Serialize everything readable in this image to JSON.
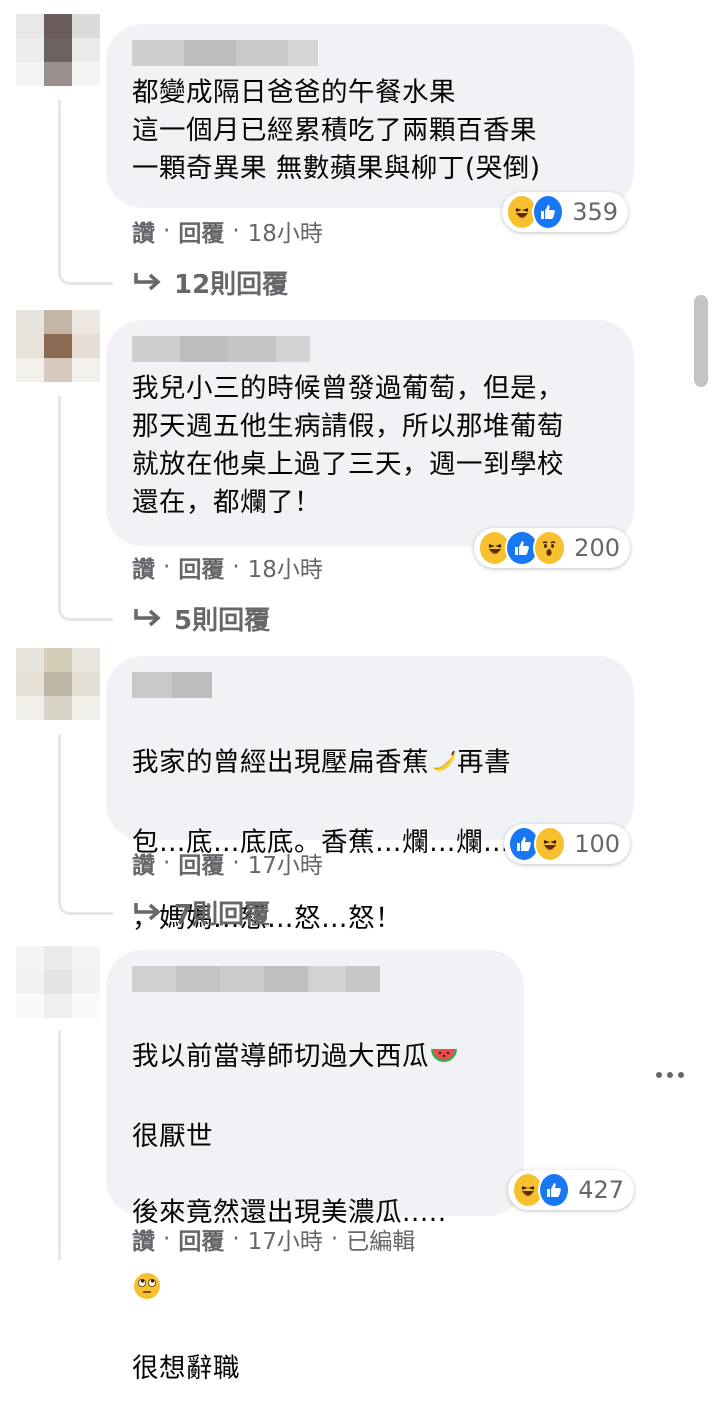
{
  "comments": [
    {
      "lines": "都變成隔日爸爸的午餐水果\n這一個月已經累積吃了兩顆百香果\n一顆奇異果 無數蘋果與柳丁(哭倒)",
      "reactions": [
        "haha",
        "like"
      ],
      "reaction_count": "359",
      "like_label": "讚",
      "reply_label": "回覆",
      "time": "18小時",
      "replies_label": "12則回覆"
    },
    {
      "lines": "我兒小三的時候曾發過葡萄，但是，\n那天週五他生病請假，所以那堆葡萄\n就放在他桌上過了三天，週一到學校\n還在，都爛了！",
      "reactions": [
        "haha",
        "like",
        "wow"
      ],
      "reaction_count": "200",
      "like_label": "讚",
      "reply_label": "回覆",
      "time": "18小時",
      "replies_label": "5則回覆"
    },
    {
      "line1": "我家的曾經出現壓扁香蕉",
      "line1_emoji": "banana",
      "line1_tail": "再書",
      "line2": "包…底…底底。香蕉…爛…爛…爛",
      "line3": "，媽媽…怒…怒…怒！",
      "reactions": [
        "like",
        "haha"
      ],
      "reaction_count": "100",
      "like_label": "讚",
      "reply_label": "回覆",
      "time": "17小時",
      "replies_label": "7則回覆"
    },
    {
      "line1": "我以前當導師切過大西瓜",
      "line1_emoji": "watermelon",
      "line2": "很厭世",
      "line3": "後來竟然還出現美濃瓜.....",
      "line4_emoji": "face-with-rolling-eyes",
      "line5": "很想辭職",
      "reactions": [
        "haha",
        "like"
      ],
      "reaction_count": "427",
      "like_label": "讚",
      "reply_label": "回覆",
      "time": "17小時",
      "edited_label": "已編輯"
    }
  ],
  "colors": {
    "bubble": "#f0f2f5",
    "meta_text": "#65676b",
    "like_blue": "#1877f2",
    "haha_yellow": "#f7c02f"
  }
}
